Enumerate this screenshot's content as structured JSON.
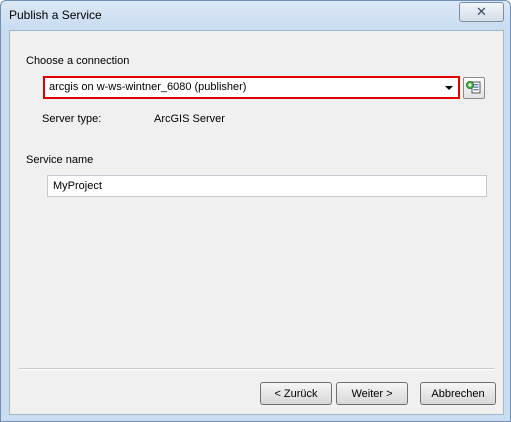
{
  "window": {
    "title": "Publish a Service",
    "close_glyph": "✕"
  },
  "connection": {
    "label": "Choose a connection",
    "selected": "arcgis on w-ws-wintner_6080 (publisher)",
    "add_icon": "add-connection-icon"
  },
  "server": {
    "label": "Server type:",
    "value": "ArcGIS Server"
  },
  "service": {
    "label": "Service name",
    "value": "MyProject"
  },
  "buttons": {
    "back": "< Zurück",
    "next": "Weiter >",
    "cancel": "Abbrechen"
  },
  "colors": {
    "highlight_border": "#e00000",
    "title_bg": "#c9dcf0"
  }
}
